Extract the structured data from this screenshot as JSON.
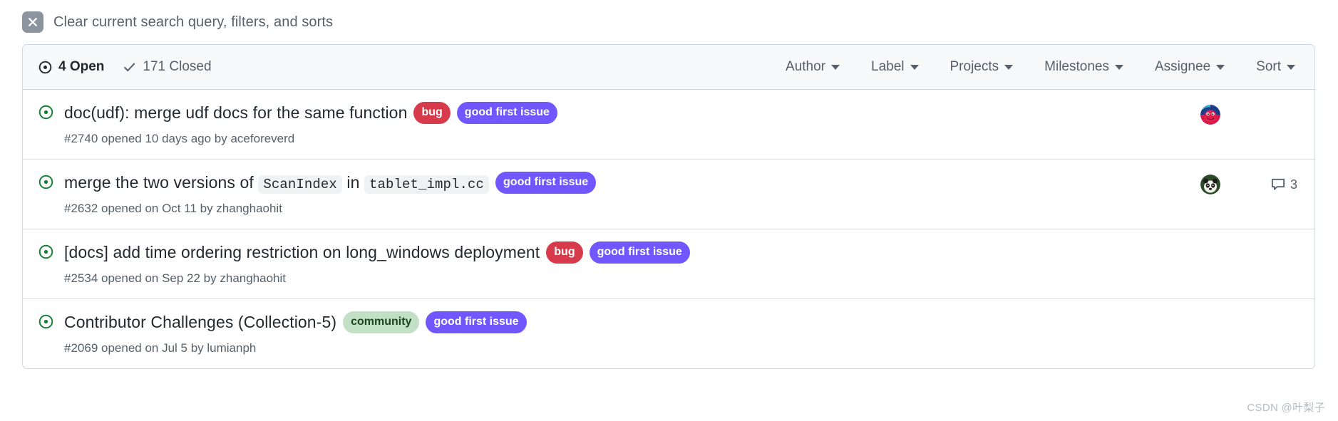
{
  "clear_bar": {
    "icon": "close-x-icon",
    "text": "Clear current search query, filters, and sorts"
  },
  "header": {
    "open": {
      "icon": "issue-opened-icon",
      "label": "4 Open"
    },
    "closed": {
      "icon": "check-icon",
      "label": "171 Closed"
    },
    "filters": [
      {
        "label": "Author"
      },
      {
        "label": "Label"
      },
      {
        "label": "Projects"
      },
      {
        "label": "Milestones"
      },
      {
        "label": "Assignee"
      },
      {
        "label": "Sort"
      }
    ]
  },
  "colors": {
    "bug_bg": "#d73a4a",
    "bug_fg": "#ffffff",
    "gfi_bg": "#7057ff",
    "gfi_fg": "#ffffff",
    "community_bg": "#c2e0c6",
    "community_fg": "#1a4721",
    "open_green": "#1a7f37",
    "header_bg": "#f6f8fa",
    "border": "#d0d7de"
  },
  "issues": [
    {
      "state_icon": "issue-opened-icon",
      "title_parts": [
        {
          "type": "text",
          "value": "doc(udf): merge udf docs for the same function"
        }
      ],
      "labels": [
        {
          "name": "bug",
          "bg": "#d73a4a",
          "fg": "#ffffff"
        },
        {
          "name": "good first issue",
          "bg": "#7057ff",
          "fg": "#ffffff"
        }
      ],
      "meta": "#2740 opened 10 days ago by aceforeverd",
      "avatar": "avatar-aceforeverd",
      "comments": null
    },
    {
      "state_icon": "issue-opened-icon",
      "title_parts": [
        {
          "type": "text",
          "value": "merge the two versions of"
        },
        {
          "type": "code",
          "value": "ScanIndex"
        },
        {
          "type": "text",
          "value": "in"
        },
        {
          "type": "code",
          "value": "tablet_impl.cc"
        }
      ],
      "labels": [
        {
          "name": "good first issue",
          "bg": "#7057ff",
          "fg": "#ffffff"
        }
      ],
      "meta": "#2632 opened on Oct 11 by zhanghaohit",
      "avatar": "avatar-zhanghaohit",
      "comments": "3"
    },
    {
      "state_icon": "issue-opened-icon",
      "title_parts": [
        {
          "type": "text",
          "value": "[docs] add time ordering restriction on long_windows deployment"
        }
      ],
      "labels": [
        {
          "name": "bug",
          "bg": "#d73a4a",
          "fg": "#ffffff"
        },
        {
          "name": "good first issue",
          "bg": "#7057ff",
          "fg": "#ffffff"
        }
      ],
      "meta": "#2534 opened on Sep 22 by zhanghaohit",
      "avatar": null,
      "comments": null
    },
    {
      "state_icon": "issue-opened-icon",
      "title_parts": [
        {
          "type": "text",
          "value": "Contributor Challenges (Collection-5)"
        }
      ],
      "labels": [
        {
          "name": "community",
          "bg": "#c2e0c6",
          "fg": "#1a4721"
        },
        {
          "name": "good first issue",
          "bg": "#7057ff",
          "fg": "#ffffff"
        }
      ],
      "meta": "#2069 opened on Jul 5 by lumianph",
      "avatar": null,
      "comments": null
    }
  ],
  "watermark": "CSDN @叶梨子"
}
